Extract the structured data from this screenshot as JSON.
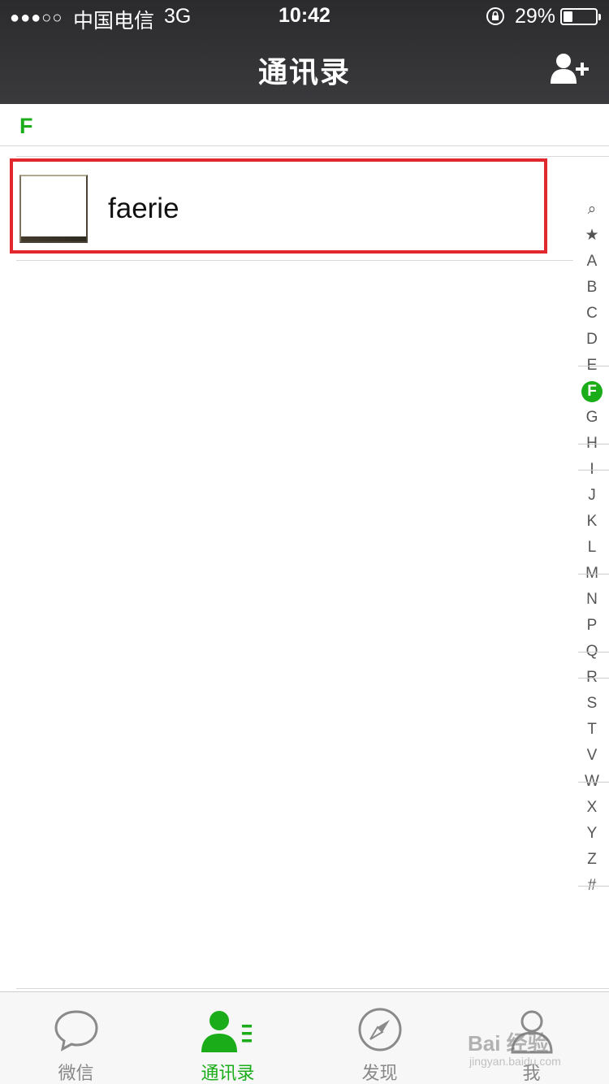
{
  "status_bar": {
    "signal": "●●●○○",
    "carrier": "中国电信",
    "network": "3G",
    "time": "10:42",
    "battery_percent": "29%",
    "battery_level": 0.29
  },
  "nav": {
    "title": "通讯录",
    "add_contact_icon": "add-contact-icon"
  },
  "section": {
    "letter": "F"
  },
  "contacts": [
    {
      "name": "faerie",
      "avatar": "avatar-photo",
      "highlighted": true
    }
  ],
  "index_bar": {
    "items": [
      "⌕",
      "★",
      "A",
      "B",
      "C",
      "D",
      "E",
      "F",
      "G",
      "H",
      "I",
      "J",
      "K",
      "L",
      "M",
      "N",
      "P",
      "Q",
      "R",
      "S",
      "T",
      "V",
      "W",
      "X",
      "Y",
      "Z",
      "#"
    ],
    "active": "F"
  },
  "tabs": [
    {
      "label": "微信",
      "icon": "chat-bubble-icon",
      "active": false
    },
    {
      "label": "通讯录",
      "icon": "contacts-icon",
      "active": true
    },
    {
      "label": "发现",
      "icon": "compass-icon",
      "active": false
    },
    {
      "label": "我",
      "icon": "person-icon",
      "active": false
    }
  ],
  "watermark": {
    "text": "Bai 经验",
    "sub": "jingyan.baidu.com"
  },
  "colors": {
    "accent": "#1aad19",
    "highlight": "#e0282e",
    "topbar": "#333336"
  }
}
